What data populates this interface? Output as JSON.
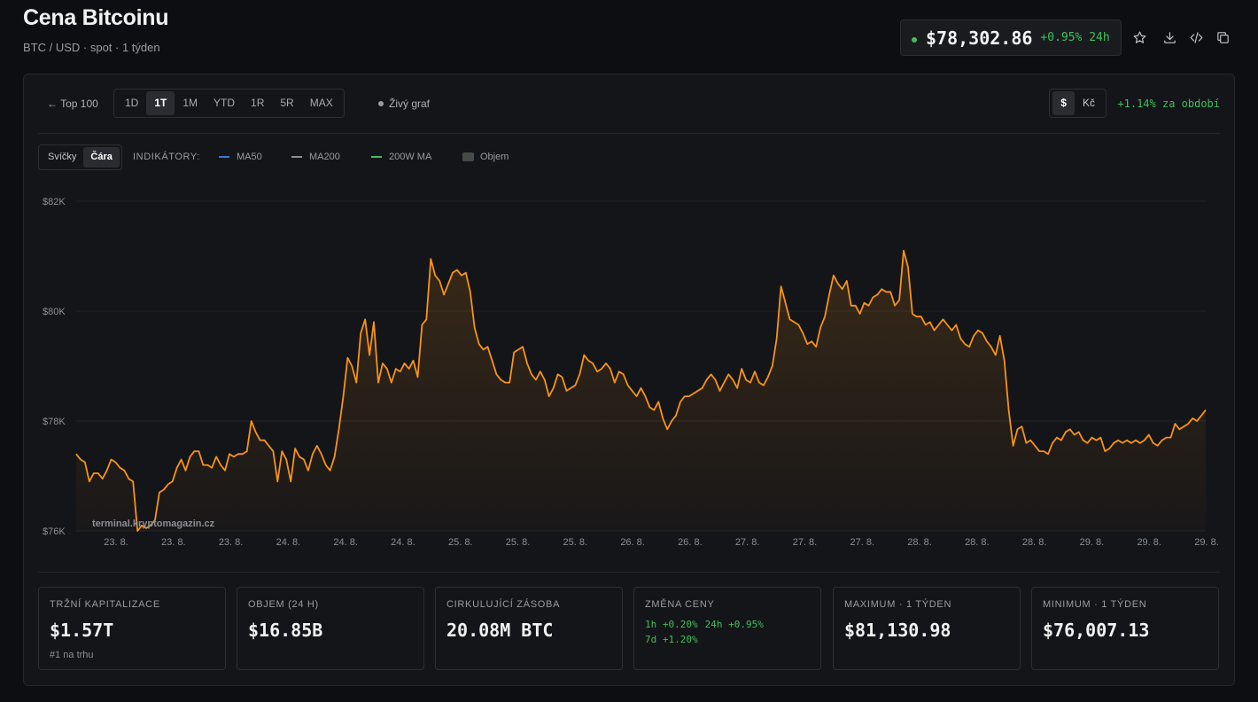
{
  "header": {
    "title": "Cena Bitcoinu",
    "subtitle": "BTC / USD · spot · 1 týden",
    "price": "$78,302.86",
    "change_24h": "+0.95% 24h"
  },
  "icons": [
    "star-icon",
    "download-icon",
    "code-icon",
    "copy-icon"
  ],
  "toolbar": {
    "back": "← Top 100",
    "ranges": [
      "1D",
      "1T",
      "1M",
      "YTD",
      "1R",
      "5R",
      "MAX"
    ],
    "active_range": "1T",
    "live_chart": "Živý graf",
    "currencies": [
      "$",
      "Kč"
    ],
    "active_currency": "$",
    "period_change": "+1.14% za období"
  },
  "chart_controls": {
    "types": [
      "Svíčky",
      "Čára"
    ],
    "active_type": "Čára",
    "indicators_label": "INDIKÁTORY:",
    "indicators": [
      {
        "name": "MA50",
        "color": "#3a7bd5",
        "kind": "line"
      },
      {
        "name": "MA200",
        "color": "#8a8d94",
        "kind": "line"
      },
      {
        "name": "200W MA",
        "color": "#3fbf5f",
        "kind": "line"
      },
      {
        "name": "Objem",
        "color": "#454b47",
        "kind": "box"
      }
    ]
  },
  "colors": {
    "line": "#f7931a",
    "positive": "#3fbf5f",
    "grid": "#22242a"
  },
  "chart_data": {
    "type": "area",
    "watermark": "terminal.kryptomagazin.cz",
    "ylim": [
      76000,
      82000
    ],
    "y_ticks": [
      "$76K",
      "$78K",
      "$80K",
      "$82K"
    ],
    "y_tick_values": [
      76000,
      78000,
      80000,
      82000
    ],
    "x_tick_labels": [
      "23. 8.",
      "23. 8.",
      "23. 8.",
      "24. 8.",
      "24. 8.",
      "24. 8.",
      "25. 8.",
      "25. 8.",
      "25. 8.",
      "26. 8.",
      "26. 8.",
      "27. 8.",
      "27. 8.",
      "27. 8.",
      "28. 8.",
      "28. 8.",
      "28. 8.",
      "29. 8.",
      "29. 8.",
      "29. 8."
    ],
    "series": [
      {
        "values": [
          77400,
          77300,
          77250,
          76900,
          77050,
          77050,
          76950,
          77100,
          77300,
          77250,
          77150,
          77100,
          76950,
          76900,
          76000,
          76100,
          76050,
          76100,
          76200,
          76700,
          76750,
          76850,
          76900,
          77150,
          77300,
          77100,
          77350,
          77450,
          77450,
          77200,
          77200,
          77150,
          77350,
          77200,
          77100,
          77400,
          77350,
          77400,
          77400,
          77450,
          78000,
          77800,
          77650,
          77650,
          77550,
          77450,
          76900,
          77450,
          77300,
          76900,
          77500,
          77350,
          77300,
          77100,
          77400,
          77550,
          77400,
          77200,
          77100,
          77350,
          77850,
          78450,
          79150,
          79000,
          78700,
          79600,
          79850,
          79200,
          79800,
          78700,
          79050,
          78950,
          78700,
          78950,
          78900,
          79050,
          78950,
          79100,
          78800,
          79750,
          79850,
          80950,
          80650,
          80550,
          80300,
          80500,
          80700,
          80750,
          80650,
          80700,
          80350,
          79700,
          79400,
          79300,
          79350,
          79100,
          78850,
          78750,
          78700,
          78700,
          79250,
          79300,
          79350,
          79050,
          78850,
          78750,
          78900,
          78750,
          78450,
          78600,
          78850,
          78800,
          78550,
          78600,
          78650,
          78850,
          79200,
          79100,
          79050,
          78900,
          78950,
          79050,
          78950,
          78700,
          78900,
          78850,
          78650,
          78550,
          78450,
          78600,
          78450,
          78250,
          78200,
          78350,
          78050,
          77850,
          78000,
          78100,
          78350,
          78450,
          78450,
          78500,
          78550,
          78600,
          78750,
          78850,
          78750,
          78550,
          78700,
          78850,
          78750,
          78600,
          78950,
          78750,
          78700,
          78900,
          78700,
          78650,
          78800,
          79000,
          79500,
          80450,
          80150,
          79850,
          79800,
          79750,
          79600,
          79400,
          79450,
          79350,
          79700,
          79900,
          80300,
          80650,
          80500,
          80400,
          80550,
          80100,
          80100,
          79950,
          80150,
          80100,
          80250,
          80300,
          80400,
          80350,
          80350,
          80100,
          80200,
          81100,
          80800,
          79950,
          79900,
          79900,
          79750,
          79800,
          79650,
          79750,
          79850,
          79750,
          79650,
          79750,
          79500,
          79400,
          79350,
          79550,
          79650,
          79600,
          79450,
          79350,
          79200,
          79550,
          79100,
          78200,
          77550,
          77850,
          77900,
          77600,
          77650,
          77550,
          77450,
          77450,
          77400,
          77600,
          77700,
          77650,
          77800,
          77850,
          77750,
          77800,
          77650,
          77600,
          77700,
          77650,
          77700,
          77450,
          77500,
          77600,
          77650,
          77600,
          77650,
          77600,
          77650,
          77600,
          77650,
          77750,
          77600,
          77550,
          77650,
          77700,
          77700,
          77950,
          77850,
          77900,
          77950,
          78050,
          78000,
          78100,
          78200
        ]
      }
    ]
  },
  "stats": [
    {
      "label": "TRŽNÍ KAPITALIZACE",
      "value": "$1.57T",
      "sub": "#1 na trhu"
    },
    {
      "label": "OBJEM (24 H)",
      "value": "$16.85B"
    },
    {
      "label": "CIRKULUJÍCÍ ZÁSOBA",
      "value": "20.08M BTC"
    },
    {
      "label": "ZMĚNA CENY",
      "changes": [
        "1h +0.20%",
        "24h +0.95%",
        "7d +1.20%"
      ]
    },
    {
      "label": "MAXIMUM · 1 TÝDEN",
      "value": "$81,130.98"
    },
    {
      "label": "MINIMUM · 1 TÝDEN",
      "value": "$76,007.13"
    }
  ]
}
